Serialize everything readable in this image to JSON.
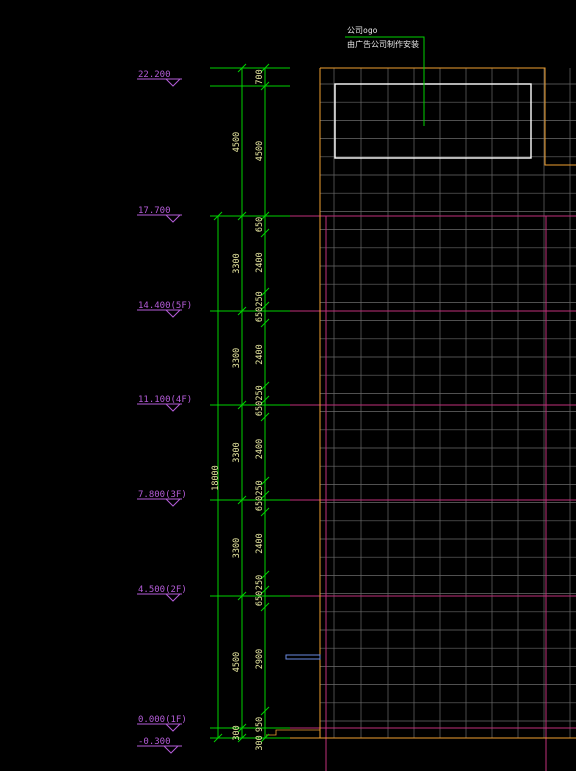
{
  "annotation": {
    "line1": "公司ogo",
    "line2": "由广告公司制作安装"
  },
  "levels": [
    {
      "label": "22.200"
    },
    {
      "label": "17.700"
    },
    {
      "label": "14.400(5F)"
    },
    {
      "label": "11.100(4F)"
    },
    {
      "label": "7.800(3F)"
    },
    {
      "label": "4.500(2F)"
    },
    {
      "label": "0.000(1F)"
    },
    {
      "label": "-0.300"
    }
  ],
  "dimensions": {
    "total_height": "18000",
    "floor_heights": [
      "4500",
      "3300",
      "3300",
      "3300",
      "3300",
      "4500",
      "300"
    ],
    "outer_chain": [
      "700",
      "4500",
      "650",
      "2400",
      "250",
      "650",
      "2400",
      "250",
      "650",
      "2400",
      "250",
      "650",
      "2400",
      "250",
      "650",
      "2900",
      "950",
      "300"
    ]
  },
  "colors": {
    "background": "#000000",
    "dimension": "#00d200",
    "level_marker": "#b45cd8",
    "facade_outline": "#f0a030",
    "grid": "#6a6a6a",
    "floor_line": "#c0307a",
    "logo_box": "#ffffff",
    "leader": "#00d200"
  }
}
